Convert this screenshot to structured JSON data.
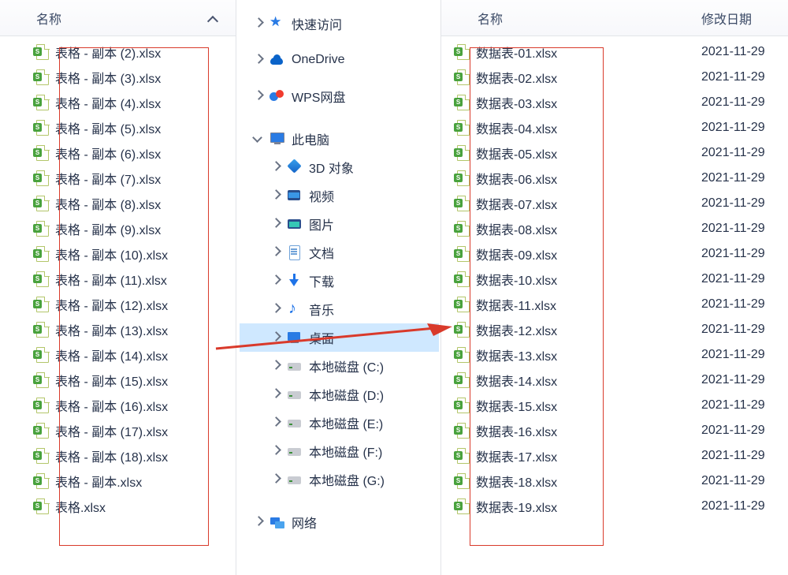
{
  "left": {
    "header": "名称",
    "files": [
      "表格 - 副本 (2).xlsx",
      "表格 - 副本 (3).xlsx",
      "表格 - 副本 (4).xlsx",
      "表格 - 副本 (5).xlsx",
      "表格 - 副本 (6).xlsx",
      "表格 - 副本 (7).xlsx",
      "表格 - 副本 (8).xlsx",
      "表格 - 副本 (9).xlsx",
      "表格 - 副本 (10).xlsx",
      "表格 - 副本 (11).xlsx",
      "表格 - 副本 (12).xlsx",
      "表格 - 副本 (13).xlsx",
      "表格 - 副本 (14).xlsx",
      "表格 - 副本 (15).xlsx",
      "表格 - 副本 (16).xlsx",
      "表格 - 副本 (17).xlsx",
      "表格 - 副本 (18).xlsx",
      "表格 - 副本.xlsx",
      "表格.xlsx"
    ]
  },
  "tree": [
    {
      "depth": 0,
      "twixty": "right",
      "icon": "ic-star",
      "label": "快速访问"
    },
    {
      "depth": 0,
      "twixty": "right",
      "icon": "ic-cloud",
      "label": "OneDrive"
    },
    {
      "depth": 0,
      "twixty": "right",
      "icon": "ic-wps",
      "label": "WPS网盘"
    },
    {
      "depth": 0,
      "twixty": "down",
      "icon": "ic-pc",
      "label": "此电脑"
    },
    {
      "depth": 1,
      "twixty": "right",
      "icon": "ic-3d",
      "label": "3D 对象"
    },
    {
      "depth": 1,
      "twixty": "right",
      "icon": "ic-video",
      "label": "视频"
    },
    {
      "depth": 1,
      "twixty": "right",
      "icon": "ic-pic",
      "label": "图片"
    },
    {
      "depth": 1,
      "twixty": "right",
      "icon": "ic-doc",
      "label": "文档"
    },
    {
      "depth": 1,
      "twixty": "right",
      "icon": "ic-down",
      "label": "下载"
    },
    {
      "depth": 1,
      "twixty": "right",
      "icon": "ic-music",
      "label": "音乐"
    },
    {
      "depth": 1,
      "twixty": "right",
      "icon": "ic-desk",
      "label": "桌面",
      "selected": true
    },
    {
      "depth": 1,
      "twixty": "right",
      "icon": "ic-disk",
      "label": "本地磁盘 (C:)"
    },
    {
      "depth": 1,
      "twixty": "right",
      "icon": "ic-disk",
      "label": "本地磁盘 (D:)"
    },
    {
      "depth": 1,
      "twixty": "right",
      "icon": "ic-disk",
      "label": "本地磁盘 (E:)"
    },
    {
      "depth": 1,
      "twixty": "right",
      "icon": "ic-disk",
      "label": "本地磁盘 (F:)"
    },
    {
      "depth": 1,
      "twixty": "right",
      "icon": "ic-disk",
      "label": "本地磁盘 (G:)"
    },
    {
      "depth": 0,
      "twixty": "right",
      "icon": "ic-net",
      "label": "网络"
    }
  ],
  "right": {
    "header_name": "名称",
    "header_date": "修改日期",
    "files": [
      {
        "name": "数据表-01.xlsx",
        "date": "2021-11-29"
      },
      {
        "name": "数据表-02.xlsx",
        "date": "2021-11-29"
      },
      {
        "name": "数据表-03.xlsx",
        "date": "2021-11-29"
      },
      {
        "name": "数据表-04.xlsx",
        "date": "2021-11-29"
      },
      {
        "name": "数据表-05.xlsx",
        "date": "2021-11-29"
      },
      {
        "name": "数据表-06.xlsx",
        "date": "2021-11-29"
      },
      {
        "name": "数据表-07.xlsx",
        "date": "2021-11-29"
      },
      {
        "name": "数据表-08.xlsx",
        "date": "2021-11-29"
      },
      {
        "name": "数据表-09.xlsx",
        "date": "2021-11-29"
      },
      {
        "name": "数据表-10.xlsx",
        "date": "2021-11-29"
      },
      {
        "name": "数据表-11.xlsx",
        "date": "2021-11-29"
      },
      {
        "name": "数据表-12.xlsx",
        "date": "2021-11-29"
      },
      {
        "name": "数据表-13.xlsx",
        "date": "2021-11-29"
      },
      {
        "name": "数据表-14.xlsx",
        "date": "2021-11-29"
      },
      {
        "name": "数据表-15.xlsx",
        "date": "2021-11-29"
      },
      {
        "name": "数据表-16.xlsx",
        "date": "2021-11-29"
      },
      {
        "name": "数据表-17.xlsx",
        "date": "2021-11-29"
      },
      {
        "name": "数据表-18.xlsx",
        "date": "2021-11-29"
      },
      {
        "name": "数据表-19.xlsx",
        "date": "2021-11-29"
      }
    ]
  }
}
